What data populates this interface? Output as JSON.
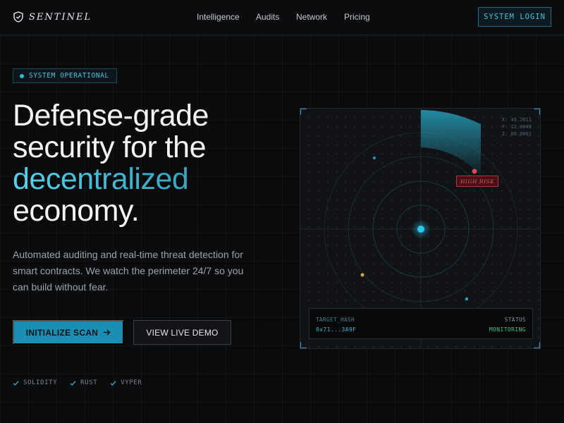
{
  "nav": {
    "brand": "SENTINEL",
    "brand_icon": "shield-icon",
    "links": [
      "Intelligence",
      "Audits",
      "Network",
      "Pricing"
    ],
    "login_label": "SYSTEM LOGIN"
  },
  "hero": {
    "status_badge": "SYSTEM OPERATIONAL",
    "headline_line1": "Defense-grade",
    "headline_line2": "security for the",
    "headline_accent": "decentralized",
    "headline_line4": "economy.",
    "subtext": "Automated auditing and real-time threat detection for smart contracts. We watch the perimeter 24/7 so you can build without fear.",
    "primary_cta": "INITIALIZE SCAN",
    "secondary_cta": "VIEW LIVE DEMO",
    "languages": [
      "SOLIDITY",
      "RUST",
      "VYPER"
    ]
  },
  "radar": {
    "coords": [
      "X: 49.2011",
      "Y: 12.0049",
      "Z: 00.0001"
    ],
    "alert_label": "HIGH RISK",
    "target_hash_label": "TARGET_HASH",
    "target_hash_value": "0x71...3A9F",
    "status_label": "STATUS",
    "status_value": "MONITORING"
  },
  "colors": {
    "accent": "#1b8fb3",
    "accent_light": "#46c0dc",
    "danger": "#e0565d",
    "success": "#45c47f",
    "warning": "#e0a526",
    "background": "#0a0b0d"
  }
}
